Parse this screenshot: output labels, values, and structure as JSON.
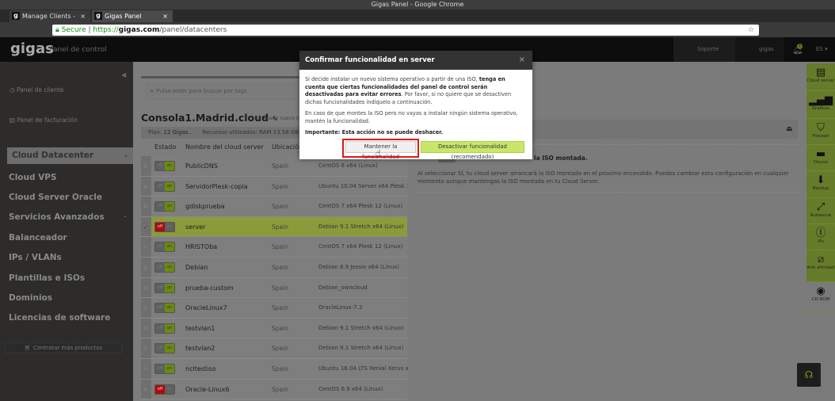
{
  "browser": {
    "window_title": "Gigas Panel - Google Chrome",
    "tabs": [
      {
        "label": "Manage Clients - Giga"
      },
      {
        "label": "Gigas Panel"
      }
    ],
    "secure_label": "Secure",
    "url_scheme": "https://",
    "url_host": "gigas.com",
    "url_path": "/panel/datacenters"
  },
  "header": {
    "logo": "gigas",
    "subtitle": "Panel de control",
    "support": "Soporte técnico ▾",
    "user": "gigas com ▾",
    "notifications": "1",
    "lang": "ES ▾"
  },
  "sidebar": {
    "client_panel": "Panel de cliente",
    "billing_panel": "Panel de facturación",
    "selected": "Cloud Datacenter",
    "items": [
      "Cloud VPS",
      "Cloud Server Oracle",
      "Servicios Avanzados",
      "Balanceador",
      "IPs / VLANs",
      "Plantillas e ISOs",
      "Dominios",
      "Licencias de software"
    ],
    "buy_more": "Contratar más productos"
  },
  "main": {
    "search_placeholder": "Pulsa enter para buscar por tags",
    "title": "Consola1.Madrid.cloud",
    "add_new": "Añadir nuevo clo",
    "plan_label": "Plan:",
    "plan_value": "12 Gigas..",
    "resources_label": "Recursos utilizados:",
    "ram_label": "RAM",
    "ram_value": "13.58 GB de",
    "columns": [
      "Estado",
      "Nombre del cloud server",
      "Ubicación"
    ],
    "rows": [
      {
        "name": "PublicDNS",
        "location": "Spain",
        "os": "CentOS 6 x64 (Linux)",
        "state": "on",
        "selected": false
      },
      {
        "name": "ServidorPlesk-copia",
        "location": "Spain",
        "os": "Ubuntu 10.04 Server x64 Plesk 10...",
        "state": "on",
        "selected": false
      },
      {
        "name": "gdiskprueba",
        "location": "Spain",
        "os": "CentOS 7 x64 Plesk 12 (Linux)",
        "state": "on",
        "selected": false
      },
      {
        "name": "server",
        "location": "Spain",
        "os": "Debian 9.1 Stretch x64 (Linux)",
        "state": "off",
        "selected": true
      },
      {
        "name": "HRISTOba",
        "location": "Spain",
        "os": "CentOS 7 x64 Plesk 12 (Linux)",
        "state": "on",
        "selected": false
      },
      {
        "name": "Debian",
        "location": "Spain",
        "os": "Debian 8.9 Jessie x64 (Linux)",
        "state": "on",
        "selected": false
      },
      {
        "name": "prueba-custom",
        "location": "Spain",
        "os": "Debian_owncloud",
        "state": "on",
        "selected": false
      },
      {
        "name": "OracleLinux7",
        "location": "Spain",
        "os": "OracleLinux-7.3",
        "state": "on",
        "selected": false
      },
      {
        "name": "testvlan1",
        "location": "Spain",
        "os": "Debian 9.1 Stretch x64 (Linux)",
        "state": "on",
        "selected": false
      },
      {
        "name": "testvlan2",
        "location": "Spain",
        "os": "Debian 9.1 Stretch x64 (Linux)",
        "state": "on",
        "selected": false
      },
      {
        "name": "ncltestiso",
        "location": "Spain",
        "os": "Ubuntu 16.04 LTS Xenial Xerus x6...",
        "state": "on",
        "selected": false
      },
      {
        "name": "Oracle-Linux6",
        "location": "Spain",
        "os": "CentOS 6.9 x64 (Linux)",
        "state": "off",
        "selected": false
      }
    ],
    "toggle_off": "off",
    "toggle_on": "on"
  },
  "detail": {
    "iso_label": "la ISO montada.",
    "iso_desc": "Al seleccionar SÍ, tu cloud server arrancará la ISO montada en el proximo encendido. Puedes cambiar esta configuración en cualquier momento aunque mantengas la ISO montada en tu Cloud Server."
  },
  "rail": [
    {
      "label": "Cloud server",
      "icon": "server-icon"
    },
    {
      "label": "Graficas",
      "icon": "bar-chart-icon"
    },
    {
      "label": "Firewall",
      "icon": "shield-icon"
    },
    {
      "label": "Discos",
      "icon": "disk-icon"
    },
    {
      "label": "Backup",
      "icon": "backup-icon"
    },
    {
      "label": "Autoescal",
      "icon": "resize-icon"
    },
    {
      "label": "IPs",
      "icon": "ips-icon"
    },
    {
      "label": "Anti afinidad",
      "icon": "anti-affinity-icon"
    },
    {
      "label": "CD-ROM",
      "icon": "cdrom-icon"
    }
  ],
  "modal": {
    "title": "Confirmar funcionalidad en server",
    "close": "×",
    "p1_a": "Si decide instalar un nuevo sistema operativo a partir de una ISO, ",
    "p1_b": "tenga en cuenta que ciertas funcionalidades del panel de control serán desactivadas para evitar errores",
    "p1_c": ". Por favor, si no quiere que se desactiven dichas funcionalidades indíquelo a continuación.",
    "p2": "En caso de que montes la ISO pero no vayas a instalar ningún sistema operativo, mantén la funcionalidad.",
    "p3": "Importante: Esta acción no se puede deshacer.",
    "keep": "Mantener la funcionalidad",
    "disable": "Desactivar funcionalidad (recomendado)"
  },
  "colors": {
    "accent_green": "#8cc63f",
    "danger_red": "#e01818",
    "off_red": "#aa0e0e"
  }
}
